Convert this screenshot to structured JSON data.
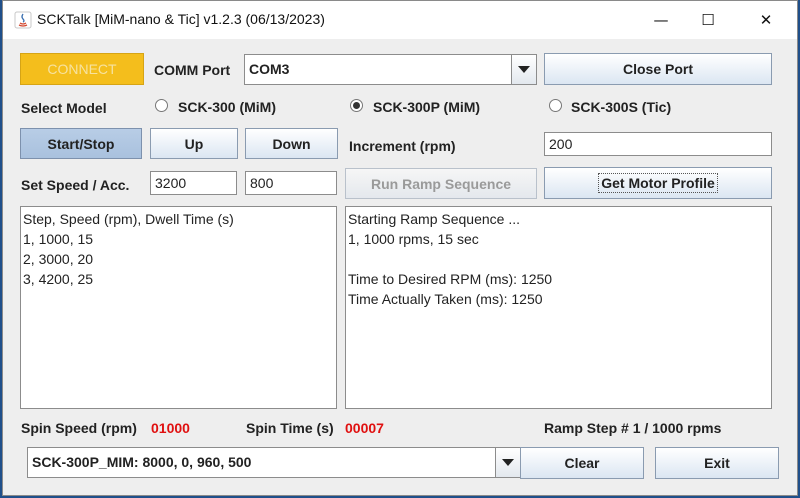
{
  "window": {
    "title": "SCKTalk [MiM-nano & Tic] v1.2.3 (06/13/2023)",
    "minimize_glyph": "—",
    "maximize_glyph": "☐",
    "close_glyph": "✕"
  },
  "connection": {
    "connect_label": "CONNECT",
    "comm_port_label": "COMM Port",
    "comm_port_value": "COM3",
    "close_port_label": "Close Port"
  },
  "model": {
    "label": "Select Model",
    "options": [
      {
        "label": "SCK-300 (MiM)",
        "selected": false
      },
      {
        "label": "SCK-300P (MiM)",
        "selected": true
      },
      {
        "label": "SCK-300S (Tic)",
        "selected": false
      }
    ]
  },
  "controls": {
    "start_stop_label": "Start/Stop",
    "up_label": "Up",
    "down_label": "Down",
    "increment_label": "Increment (rpm)",
    "increment_value": "200",
    "set_speed_label": "Set Speed / Acc.",
    "speed_value": "3200",
    "acc_value": "800",
    "run_ramp_label": "Run Ramp Sequence",
    "get_profile_label": "Get Motor Profile"
  },
  "sequence_text": [
    "Step, Speed (rpm), Dwell Time (s)",
    "1, 1000, 15",
    "2, 3000, 20",
    "3, 4200, 25"
  ],
  "log_text": [
    "Starting Ramp Sequence ...",
    "1, 1000 rpms, 15 sec",
    "",
    "Time to Desired RPM (ms): 1250",
    "Time Actually Taken (ms): 1250"
  ],
  "status": {
    "spin_speed_label": "Spin Speed (rpm)",
    "spin_speed_value": "01000",
    "spin_time_label": "Spin Time (s)",
    "spin_time_value": "00007",
    "ramp_step_text": "Ramp Step # 1 / 1000 rpms"
  },
  "footer": {
    "profile_value": "SCK-300P_MIM: 8000, 0, 960, 500",
    "clear_label": "Clear",
    "exit_label": "Exit"
  },
  "colors": {
    "connect_bg": "#f4be1c",
    "value_red": "#e01010",
    "window_bg": "#eeeeee",
    "desktop": "#1f4f8a"
  }
}
